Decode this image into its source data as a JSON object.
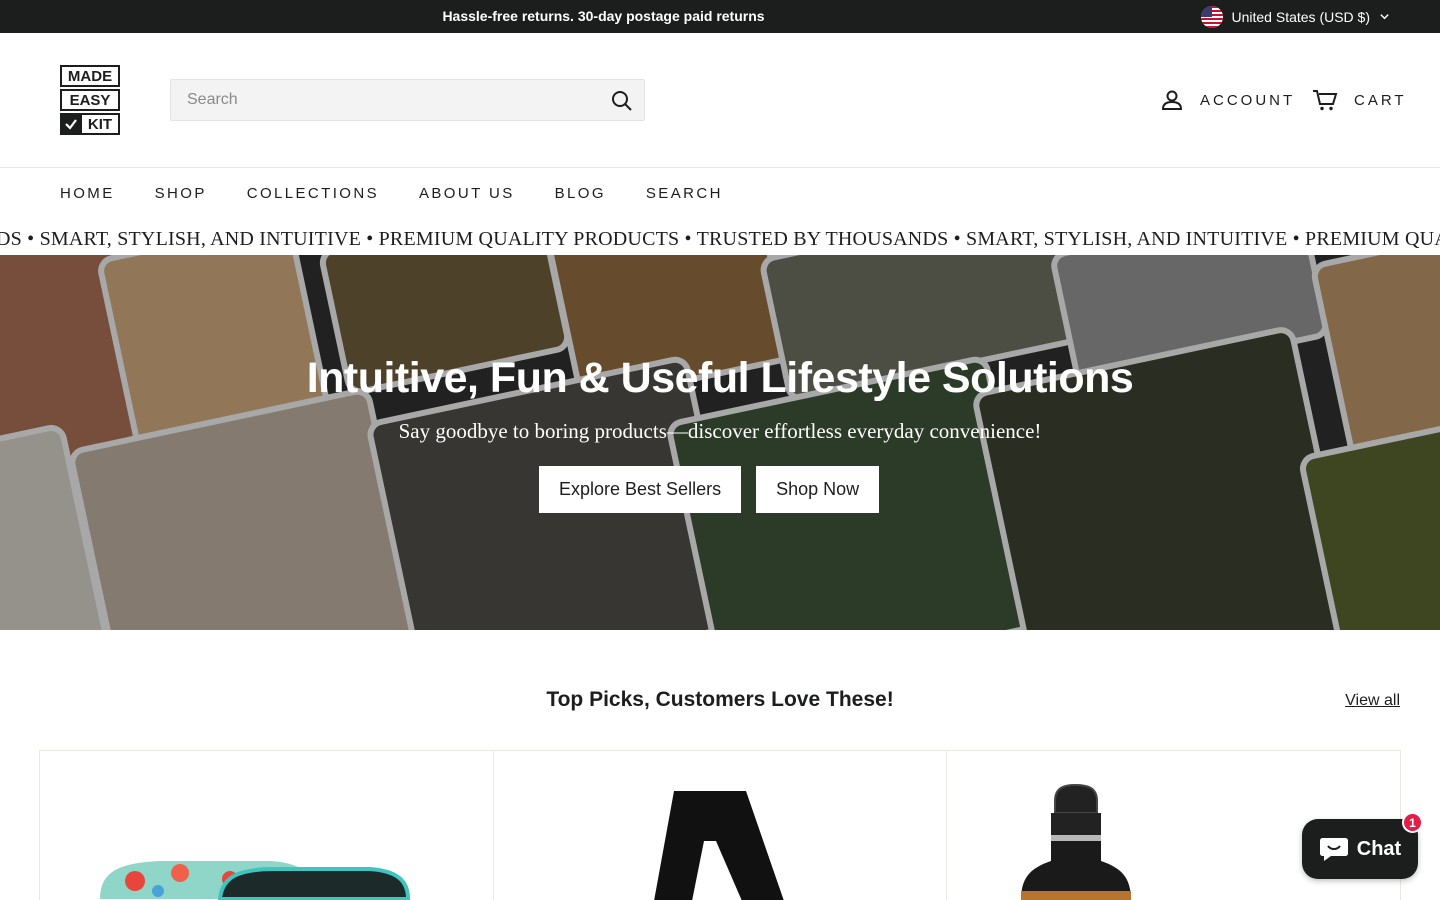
{
  "announcement": {
    "text": "Hassle-free returns. 30-day postage paid returns",
    "locale_label": "United States (USD $)"
  },
  "header": {
    "logo_lines": [
      "MADE",
      "EASY",
      "KIT"
    ],
    "search_placeholder": "Search",
    "account_label": "ACCOUNT",
    "cart_label": "CART"
  },
  "nav": {
    "items": [
      "HOME",
      "SHOP",
      "COLLECTIONS",
      "ABOUT US",
      "BLOG",
      "SEARCH"
    ]
  },
  "marquee": {
    "text": "DS • SMART, STYLISH, AND INTUITIVE  • PREMIUM QUALITY PRODUCTS • TRUSTED BY THOUSANDS • SMART, STYLISH, AND INTUITIVE  • PREMIUM QUALITY PRODUCTS"
  },
  "hero": {
    "title": "Intuitive, Fun & Useful Lifestyle Solutions",
    "subtitle": "Say goodbye to boring products—discover effortless everyday convenience!",
    "button_primary": "Explore Best Sellers",
    "button_secondary": "Shop Now"
  },
  "featured": {
    "title": "Top Picks, Customers Love These!",
    "view_all": "View all"
  },
  "chat": {
    "label": "Chat",
    "badge": "1"
  },
  "colors": {
    "dark": "#1c1d1d",
    "badge": "#e11d48"
  }
}
